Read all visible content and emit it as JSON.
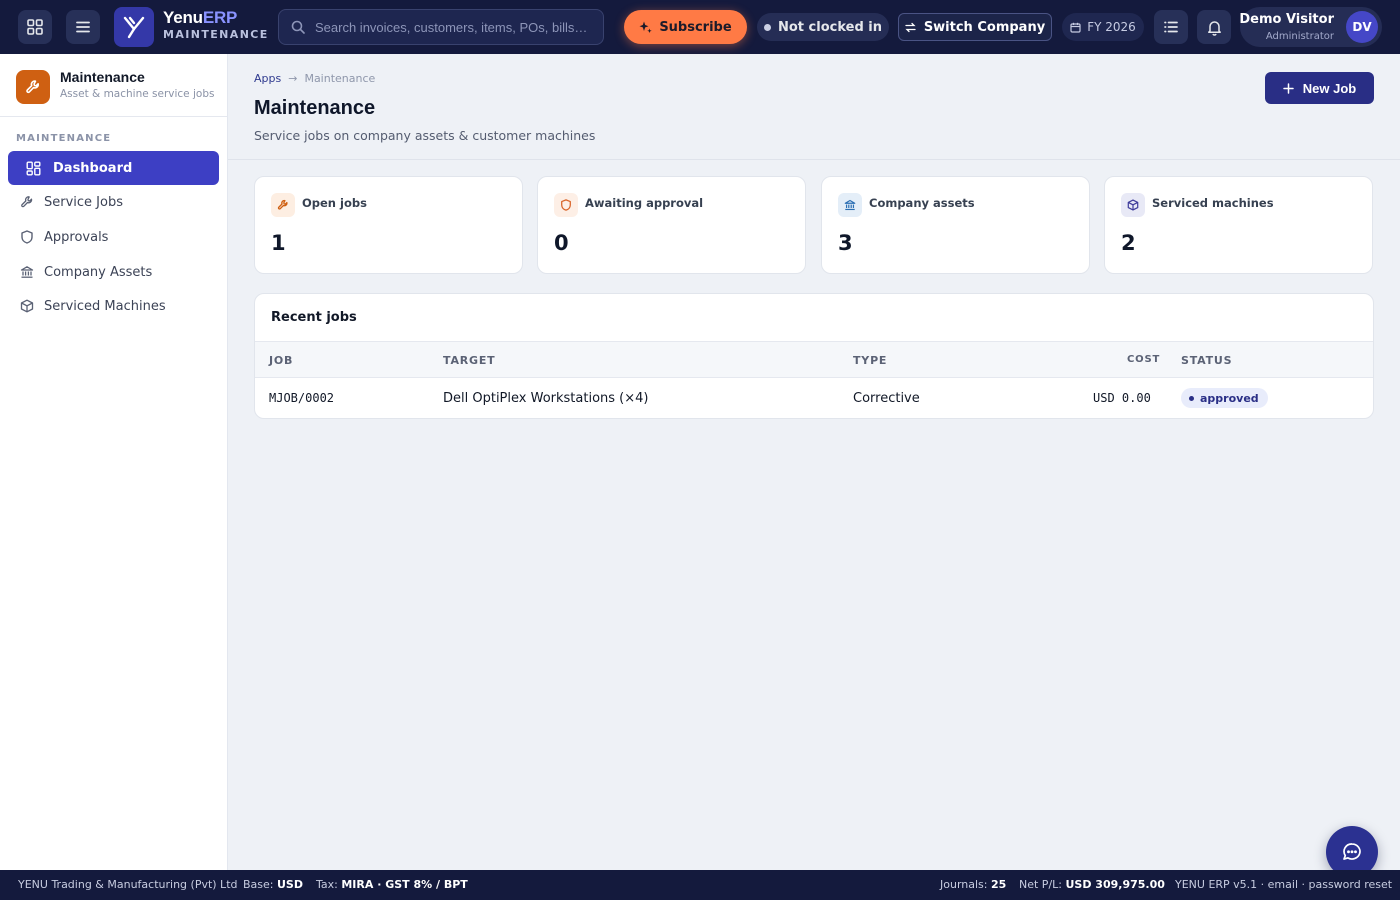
{
  "header": {
    "brand_name_1": "Yenu",
    "brand_name_2": "ERP",
    "brand_sub": "MAINTENANCE",
    "search_placeholder": "Search invoices, customers, items, POs, bills…",
    "subscribe_label": "Subscribe",
    "clock_status": "Not clocked in",
    "switch_company_label": "Switch Company",
    "fiscal_year": "FY 2026",
    "user_name": "Demo Visitor",
    "user_role": "Administrator",
    "user_initials": "DV",
    "icons": [
      "apps-grid-icon",
      "menu-icon",
      "logo-icon",
      "search-icon",
      "sparkle-icon",
      "switch-icon",
      "calendar-icon",
      "list-icon",
      "bell-icon"
    ]
  },
  "sidebar": {
    "title": "Maintenance",
    "subtitle": "Asset & machine service jobs",
    "section": "MAINTENANCE",
    "items": [
      {
        "label": "Dashboard",
        "icon": "dashboard-icon",
        "active": true
      },
      {
        "label": "Service Jobs",
        "icon": "wrench-icon",
        "active": false
      },
      {
        "label": "Approvals",
        "icon": "shield-icon",
        "active": false
      },
      {
        "label": "Company Assets",
        "icon": "bank-icon",
        "active": false
      },
      {
        "label": "Serviced Machines",
        "icon": "box-icon",
        "active": false
      }
    ]
  },
  "main": {
    "breadcrumb": [
      "Apps",
      "Maintenance"
    ],
    "title": "Maintenance",
    "subtitle": "Service jobs on company assets & customer machines",
    "new_job_label": "New Job",
    "stats": [
      {
        "label": "Open jobs",
        "value": "1",
        "icon": "wrench-icon",
        "color": "#cf6012"
      },
      {
        "label": "Awaiting approval",
        "value": "0",
        "icon": "shield-icon",
        "color": "#d9652a"
      },
      {
        "label": "Company assets",
        "value": "3",
        "icon": "bank-icon",
        "color": "#2b6fb3"
      },
      {
        "label": "Serviced machines",
        "value": "2",
        "icon": "box-icon",
        "color": "#3f3d9b"
      }
    ],
    "recent": {
      "title": "Recent jobs",
      "columns": [
        "JOB",
        "TARGET",
        "TYPE",
        "COST",
        "STATUS"
      ],
      "rows": [
        {
          "job": "MJOB/0002",
          "target": "Dell OptiPlex Workstations (×4)",
          "type": "Corrective",
          "cost": "USD 0.00",
          "status": "approved"
        }
      ]
    }
  },
  "footer": {
    "company": "YENU Trading & Manufacturing (Pvt) Ltd",
    "base_label": "Base:",
    "base_value": "USD",
    "tax_label": "Tax:",
    "tax_value": "MIRA · GST 8% / BPT",
    "journals_label": "Journals:",
    "journals_value": "25",
    "netpl_label": "Net P/L:",
    "netpl_value": "USD 309,975.00",
    "version": "YENU ERP v5.1 · email · password reset"
  },
  "colors": {
    "topbar": "#141a3d",
    "accent": "#3d3fc4",
    "subscribe": "#ff7a45",
    "primary_button": "#292e85"
  }
}
